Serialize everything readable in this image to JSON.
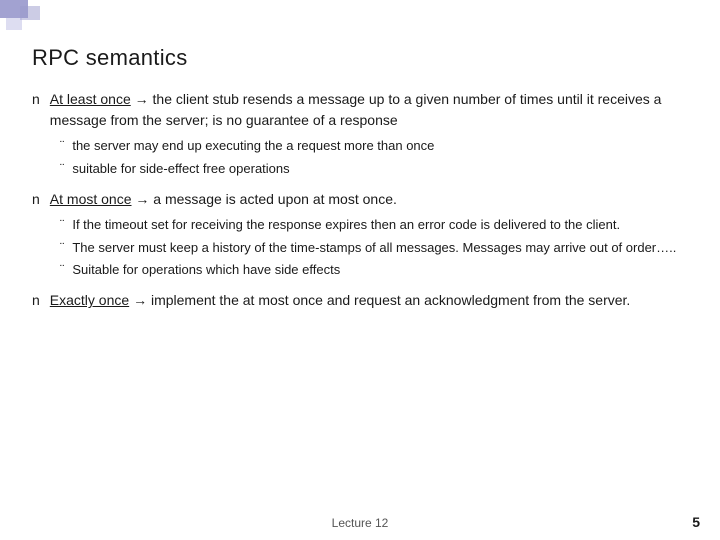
{
  "slide": {
    "title": "RPC semantics",
    "decoration": "corner-blocks",
    "sections": [
      {
        "id": "at-least-once",
        "main_text_parts": [
          {
            "text": "At least once",
            "underline": true
          },
          {
            "text": " → the client stub resends a message up to a given number of times until it receives a message from the server; is no guarantee of a response",
            "underline": false
          }
        ],
        "sub_bullets": [
          "the server may end up executing the a request more than once",
          "suitable for side-effect free operations"
        ],
        "sub_underline_words": [
          "side-effect free"
        ]
      },
      {
        "id": "at-most-once",
        "main_text_parts": [
          {
            "text": "At most once",
            "underline": true
          },
          {
            "text": " → a message is acted upon at most once.",
            "underline": false
          }
        ],
        "sub_bullets": [
          "If the timeout set for receiving the response expires then an error code is delivered to the client.",
          "The server must keep a history of the time-stamps of all messages. Messages may arrive out of order…..",
          "Suitable for operations which have side effects"
        ]
      },
      {
        "id": "exactly-once",
        "main_text_parts": [
          {
            "text": "Exactly once",
            "underline": true
          },
          {
            "text": " → implement the at most once and request an acknowledgment from the server.",
            "underline": false
          }
        ],
        "sub_bullets": []
      }
    ],
    "footer": {
      "lecture_label": "Lecture 12",
      "page_number": "5"
    }
  }
}
